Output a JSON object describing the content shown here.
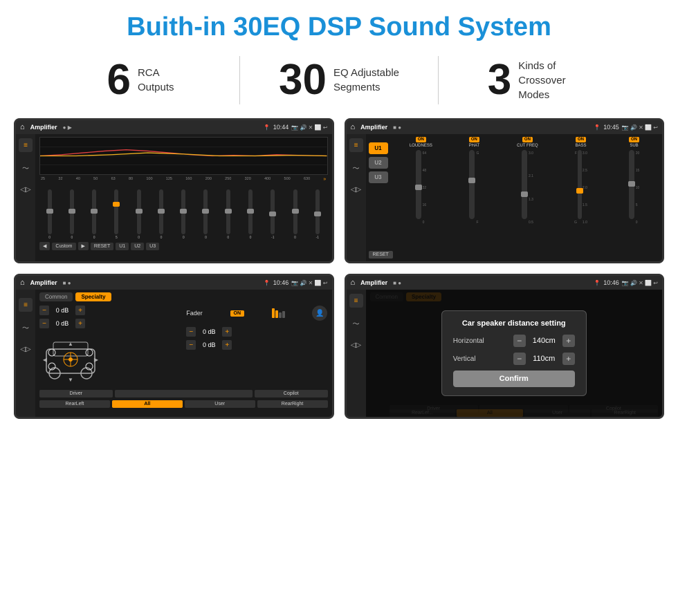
{
  "header": {
    "title": "Buith-in 30EQ DSP Sound System"
  },
  "stats": [
    {
      "number": "6",
      "label": "RCA\nOutputs"
    },
    {
      "number": "30",
      "label": "EQ Adjustable\nSegments"
    },
    {
      "number": "3",
      "label": "Kinds of\nCrossover Modes"
    }
  ],
  "screens": [
    {
      "id": "eq-screen",
      "status_bar": {
        "title": "Amplifier",
        "time": "10:44"
      },
      "type": "eq"
    },
    {
      "id": "amp-screen",
      "status_bar": {
        "title": "Amplifier",
        "time": "10:45"
      },
      "type": "amp"
    },
    {
      "id": "fader-screen",
      "status_bar": {
        "title": "Amplifier",
        "time": "10:46"
      },
      "type": "fader"
    },
    {
      "id": "dialog-screen",
      "status_bar": {
        "title": "Amplifier",
        "time": "10:46"
      },
      "type": "dialog",
      "dialog": {
        "title": "Car speaker distance setting",
        "horizontal_label": "Horizontal",
        "horizontal_value": "140cm",
        "vertical_label": "Vertical",
        "vertical_value": "110cm",
        "confirm_label": "Confirm"
      }
    }
  ],
  "eq": {
    "freqs": [
      "25",
      "32",
      "40",
      "50",
      "63",
      "80",
      "100",
      "125",
      "160",
      "200",
      "250",
      "320",
      "400",
      "500",
      "630"
    ],
    "values": [
      "0",
      "0",
      "0",
      "5",
      "0",
      "0",
      "0",
      "0",
      "0",
      "0",
      "-1",
      "0",
      "-1"
    ],
    "buttons": [
      "Custom",
      "RESET",
      "U1",
      "U2",
      "U3"
    ]
  },
  "amp": {
    "u_buttons": [
      "U1",
      "U2",
      "U3"
    ],
    "channels": [
      "LOUDNESS",
      "PHAT",
      "CUT FREQ",
      "BASS",
      "SUB"
    ]
  },
  "fader": {
    "tabs": [
      "Common",
      "Specialty"
    ],
    "fader_label": "Fader",
    "on_label": "ON",
    "vol_rows": [
      {
        "value": "0 dB"
      },
      {
        "value": "0 dB"
      },
      {
        "value": "0 dB"
      },
      {
        "value": "0 dB"
      }
    ],
    "footer_btns": [
      "Driver",
      "",
      "Copilot",
      "RearLeft",
      "All",
      "User",
      "RearRight"
    ]
  },
  "dialog": {
    "title": "Car speaker distance setting",
    "horizontal": "Horizontal",
    "horizontal_val": "140cm",
    "vertical": "Vertical",
    "vertical_val": "110cm",
    "confirm": "Confirm",
    "tabs": [
      "Common",
      "Specialty"
    ],
    "footer": [
      "Driver",
      "Copilot",
      "RearLef...",
      "User",
      "RearRight"
    ]
  }
}
